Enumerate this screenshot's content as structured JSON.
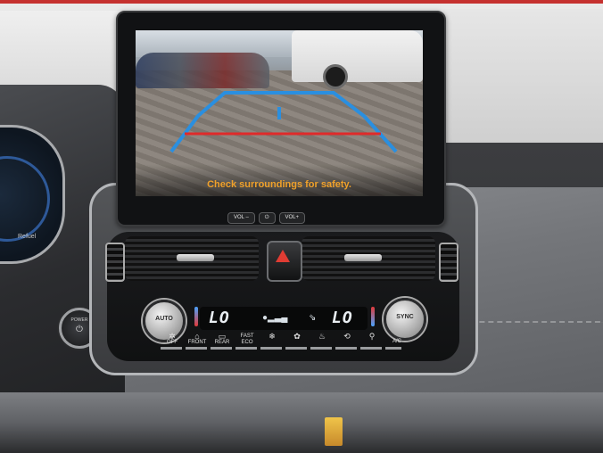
{
  "screen": {
    "message": "Check surroundings for safety.",
    "controls": [
      "VOL –",
      "⏻",
      "VOL+"
    ]
  },
  "climate": {
    "left_knob_label": "AUTO",
    "right_knob_label": "SYNC",
    "left_temp": "LO",
    "right_temp": "LO",
    "buttons": [
      {
        "label": "OFF",
        "icon": "fan-off-icon",
        "glyph": "✲"
      },
      {
        "label": "FRONT",
        "icon": "front-defrost-icon",
        "glyph": "⌂"
      },
      {
        "label": "REAR",
        "icon": "rear-defrost-icon",
        "glyph": "▭"
      },
      {
        "label": "FAST\nECO",
        "icon": "fast-eco-icon",
        "glyph": ""
      },
      {
        "label": "",
        "icon": "fan-low-icon",
        "glyph": "❄"
      },
      {
        "label": "",
        "icon": "fan-high-icon",
        "glyph": "✿"
      },
      {
        "label": "",
        "icon": "airflow-icon",
        "glyph": "♨"
      },
      {
        "label": "",
        "icon": "recirculate-icon",
        "glyph": "⟲"
      },
      {
        "label": "",
        "icon": "seat-icon",
        "glyph": "⚲"
      },
      {
        "label": "A/C",
        "icon": "ac-icon",
        "glyph": ""
      }
    ]
  },
  "console": {
    "power_label": "POWER",
    "power_icon": "power-icon",
    "hazard_icon": "hazard-icon"
  },
  "gauge": {
    "label": "Refuel"
  },
  "colors": {
    "guide_blue": "#2a8fe0",
    "guide_red": "#e02a2a",
    "message_amber": "#f0a12a",
    "hazard_red": "#e03c33"
  }
}
